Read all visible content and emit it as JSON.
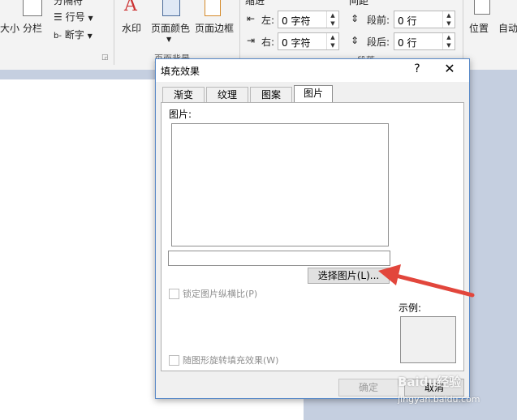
{
  "ribbon": {
    "size_frag": "大小",
    "columns": "分栏",
    "line_numbers": "行号",
    "hyphenation": "断字",
    "top_cut_frag": "分隔符",
    "watermark": "水印",
    "page_color": "页面颜色",
    "page_borders": "页面边框",
    "indent_header": "缩进",
    "indent_left_label": "左:",
    "indent_left_value": "0 字符",
    "indent_right_label": "右:",
    "indent_right_value": "0 字符",
    "spacing_header": "间距",
    "spacing_before_label": "段前:",
    "spacing_before_value": "0 行",
    "spacing_after_label": "段后:",
    "spacing_after_value": "0 行",
    "paragraph_group": "段落",
    "page_bg_group": "页面背景",
    "position": "位置",
    "wrap_frag": "自动"
  },
  "dialog": {
    "title": "填充效果",
    "help": "?",
    "close": "✕",
    "tabs": [
      "渐变",
      "纹理",
      "图案",
      "图片"
    ],
    "active_tab": "图片",
    "picture_label": "图片:",
    "select_picture_button": "选择图片(L)...",
    "lock_aspect_label": "锁定图片纵横比(P)",
    "rotate_with_shape_label": "随图形旋转填充效果(W)",
    "sample_label": "示例:",
    "ok_button": "确定",
    "cancel_button": "取消"
  },
  "watermark": {
    "brand": "Baidu经验",
    "url": "jingyan.baidu.com"
  },
  "colors": {
    "arrow": "#e2463c",
    "dialog_border": "#5a8ac8"
  }
}
